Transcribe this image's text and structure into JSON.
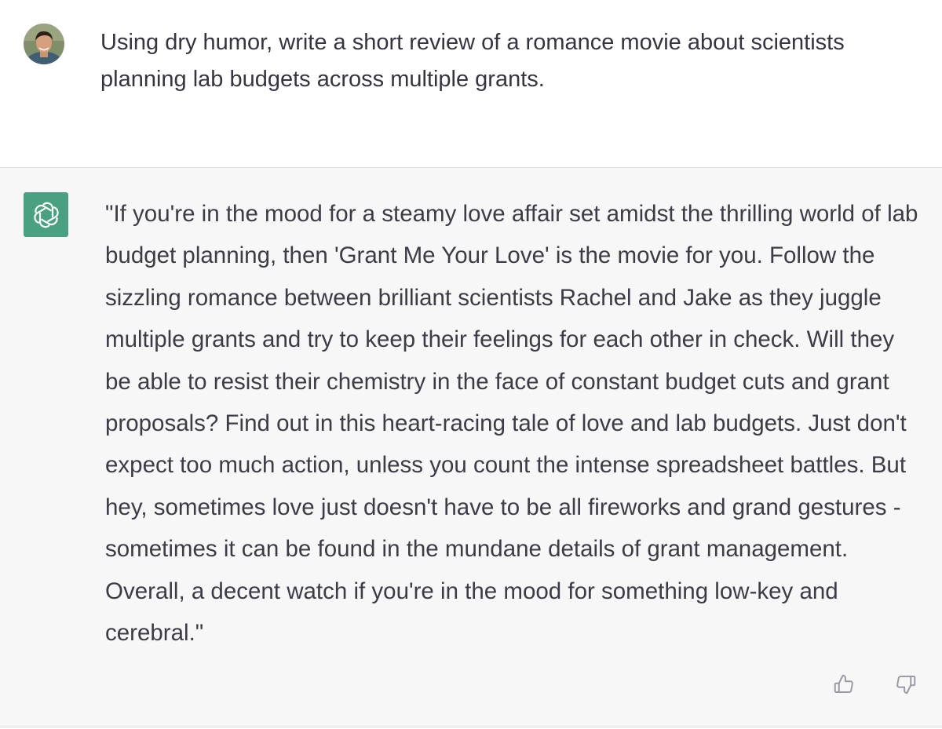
{
  "user_message": {
    "text": "Using dry humor, write a short review of a romance movie about scientists planning lab budgets across multiple grants."
  },
  "assistant_message": {
    "text": "\"If you're in the mood for a steamy love affair set amidst the thrilling world of lab budget planning, then 'Grant Me Your Love' is the movie for you. Follow the sizzling romance between brilliant scientists Rachel and Jake as they juggle multiple grants and try to keep their feelings for each other in check. Will they be able to resist their chemistry in the face of constant budget cuts and grant proposals? Find out in this heart-racing tale of love and lab budgets. Just don't expect too much action, unless you count the intense spreadsheet battles. But hey, sometimes love just doesn't have to be all fireworks and grand gestures - sometimes it can be found in the mundane details of grant management. Overall, a decent watch if you're in the mood for something low-key and cerebral.\""
  },
  "icons": {
    "avatar": "user-avatar",
    "logo": "chatgpt-logo-icon",
    "thumb_up": "thumbs-up-icon",
    "thumb_down": "thumbs-down-icon"
  },
  "colors": {
    "assistant_bg": "#f7f7f8",
    "logo_bg": "#4aa181",
    "text": "#343541"
  }
}
